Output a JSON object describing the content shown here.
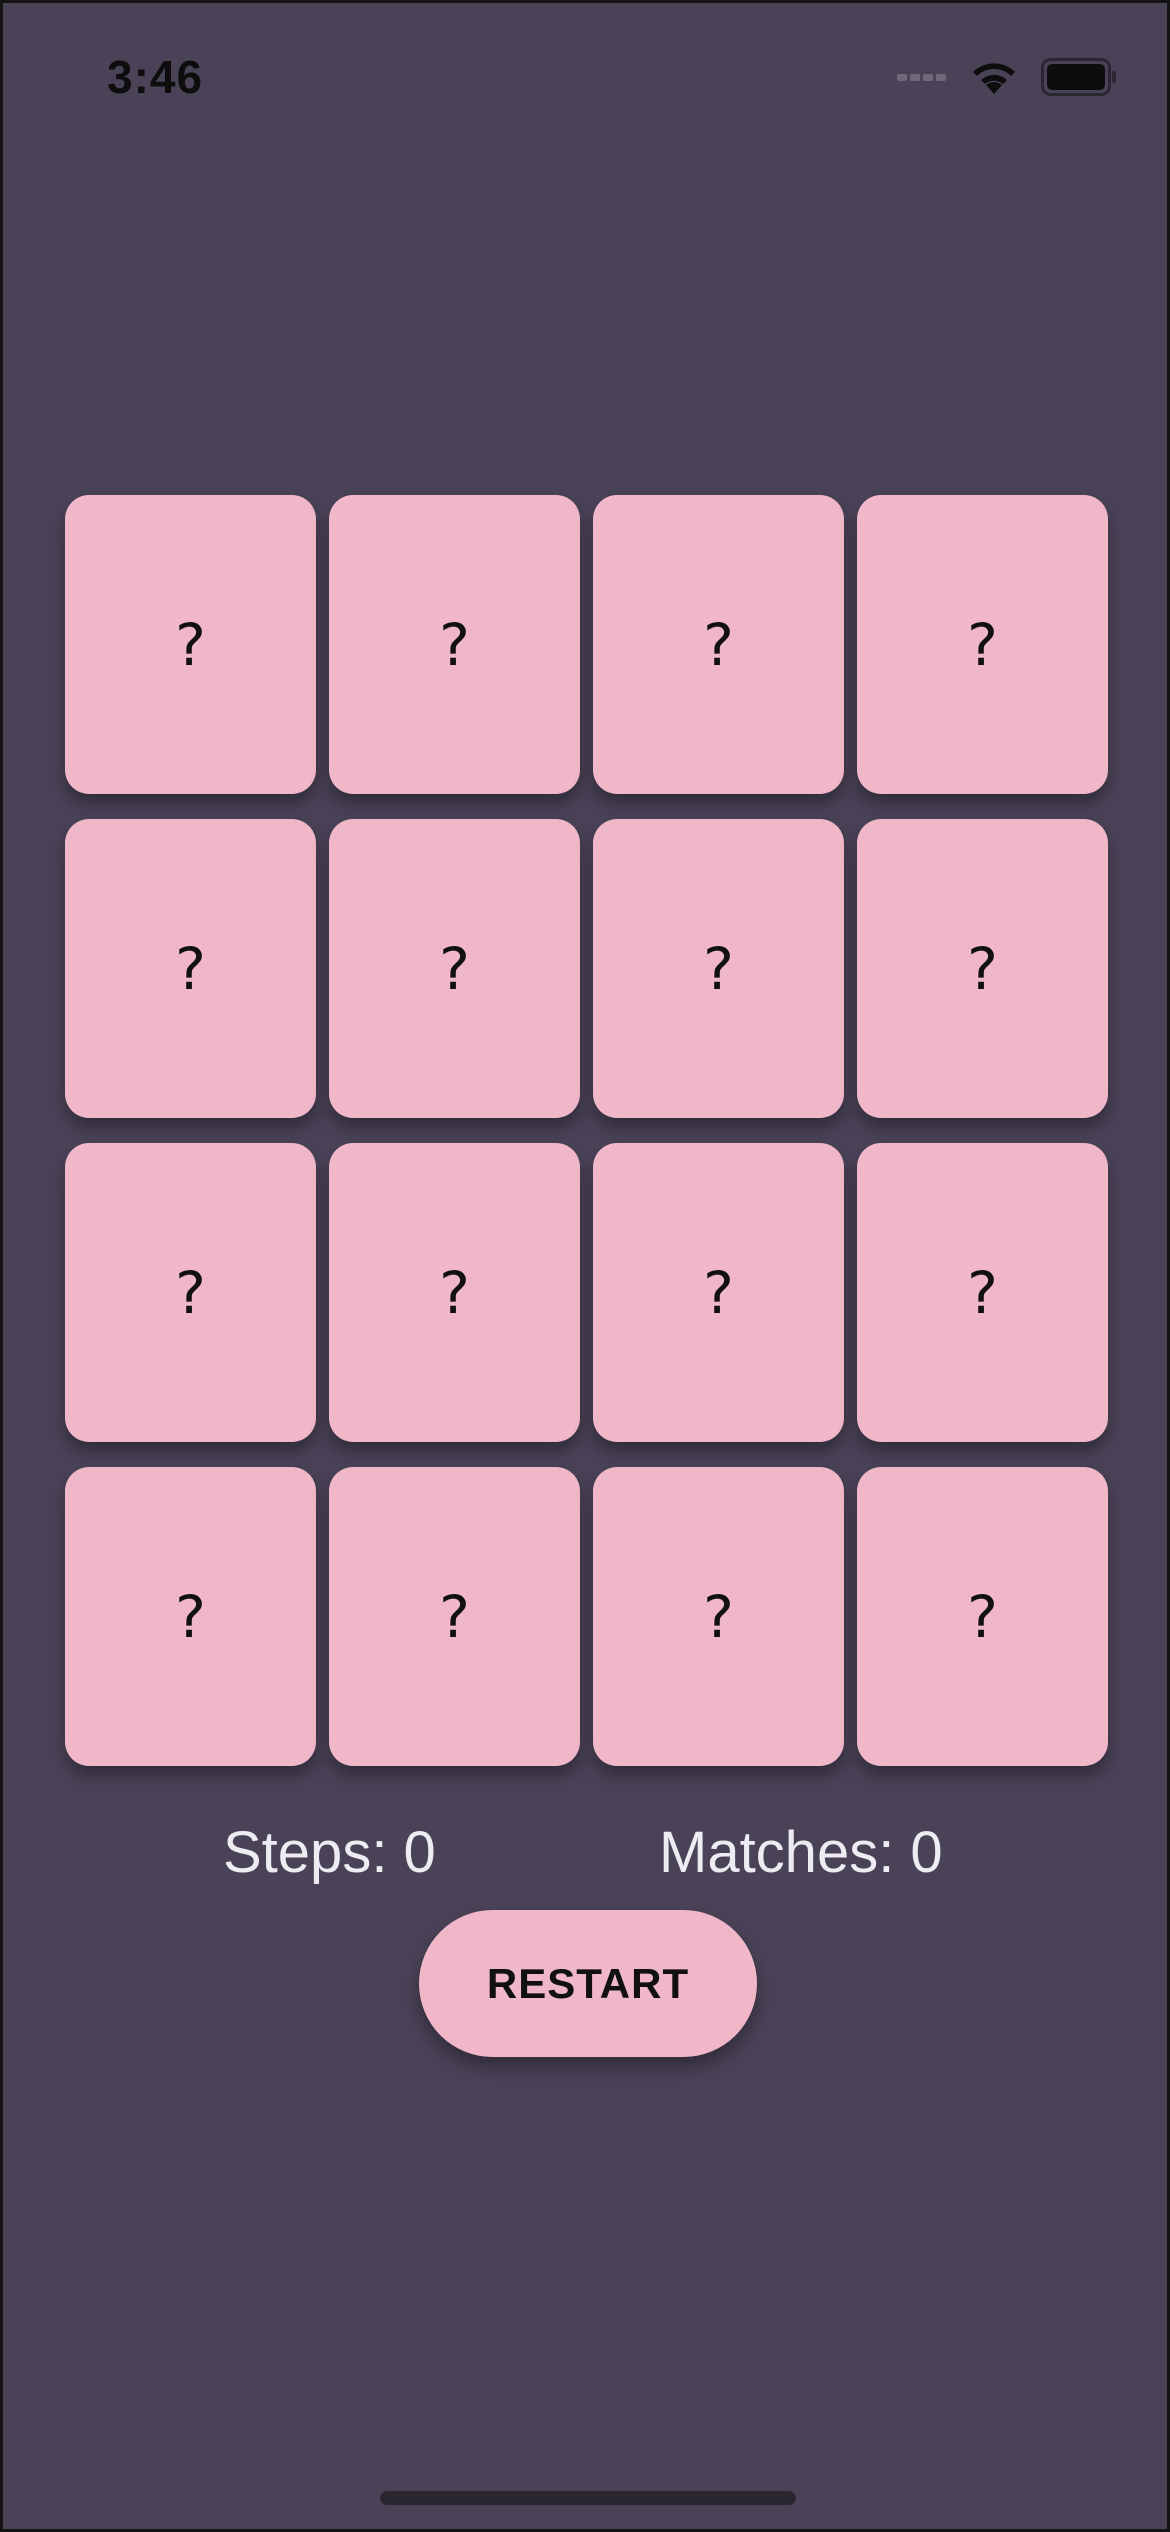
{
  "status_bar": {
    "time": "3:46",
    "icons": [
      "cellular-signal-icon",
      "wifi-icon",
      "battery-icon"
    ]
  },
  "board": {
    "cards": [
      {
        "label": "?"
      },
      {
        "label": "?"
      },
      {
        "label": "?"
      },
      {
        "label": "?"
      },
      {
        "label": "?"
      },
      {
        "label": "?"
      },
      {
        "label": "?"
      },
      {
        "label": "?"
      },
      {
        "label": "?"
      },
      {
        "label": "?"
      },
      {
        "label": "?"
      },
      {
        "label": "?"
      },
      {
        "label": "?"
      },
      {
        "label": "?"
      },
      {
        "label": "?"
      },
      {
        "label": "?"
      }
    ]
  },
  "score": {
    "steps_text": "Steps: 0",
    "matches_text": "Matches: 0"
  },
  "controls": {
    "restart_label": "RESTART"
  },
  "colors": {
    "background": "#4a4358",
    "card": "#efb7c8",
    "score_text": "#ececf2"
  }
}
